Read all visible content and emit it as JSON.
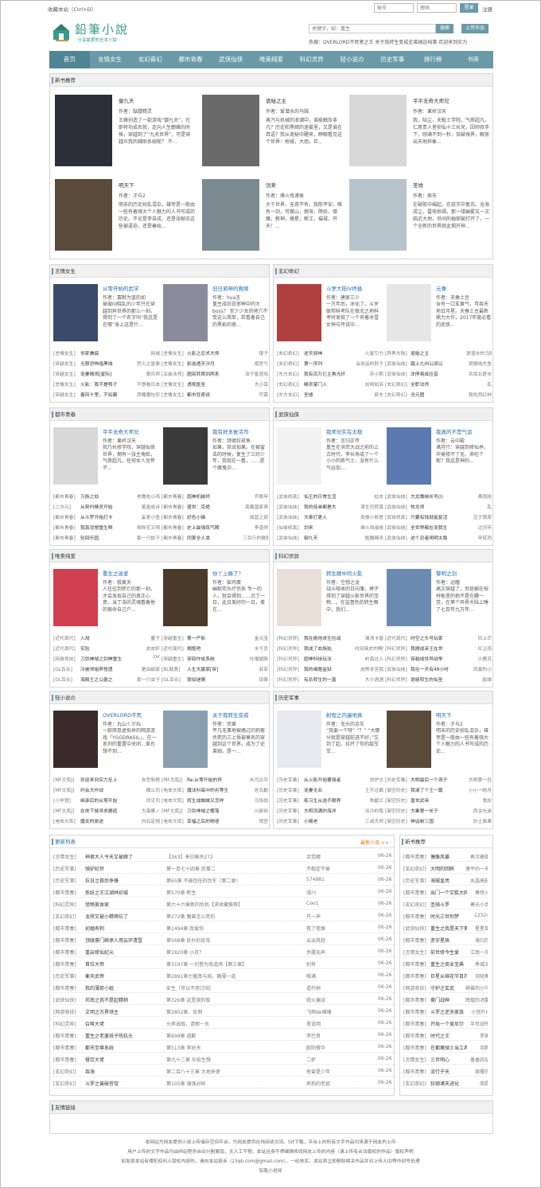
{
  "topbar": {
    "favorite": "收藏本站（Ctrl+D）",
    "account_placeholder": "帐号",
    "password_placeholder": "密码",
    "login": "登录",
    "register": "注册"
  },
  "logo": {
    "title": "鉛筆小說",
    "subtitle": "· 分享最愛的全本小說 ·"
  },
  "search": {
    "placeholder": "关键字，如：重生",
    "button": "搜索",
    "upload": "上传作品"
  },
  "hot": "热搜：OVERLORD不死者之王 关于我转生变成史莱姆这档事 欢迎来到实力",
  "nav": [
    "首页",
    "言情女生",
    "玄幻奇幻",
    "都市青春",
    "武侠仙侠",
    "唯美纯爱",
    "科幻灵异",
    "轻小说の",
    "历史军事",
    "排行榜",
    "书库"
  ],
  "new_books": {
    "title": "新书推荐",
    "items": [
      {
        "name": "御九天",
        "author": "作者：骷髅精灵",
        "desc": "王峰创造了一款游戏“御九天”，在即将功成名就，走向人生巅峰的时候，穿越到了“九天世界”，可是穿越众我的辅助系统呢？ 不...",
        "cover": "#2a2f3a"
      },
      {
        "name": "诡秘之主",
        "author": "作者：爱潜水的乌贼",
        "desc": "蒸汽与机械的浪潮中，谁能触及非凡？历史和黑暗的迷雾里，又是谁在耳语？我从诡秘中醒来，睁眼看见这个世界：枪械，大炮，巨...",
        "cover": "#6a6a6a"
      },
      {
        "name": "平平无奇大师兄",
        "author": "作者：果岭汉天",
        "desc": "我，陆尘，天魁土学院，气质超凡，仁慈贵人皆仰仙十三长兄，因师叔手下，刚满不到一秒，突破境界，解放出天地异象...",
        "cover": "#d8d8d8"
      },
      {
        "name": "明天下",
        "author": "作者：孑与2",
        "desc": "明末的历史纷乱混杂，雄宰是一般由一些有着强大个人魅力的人书写成的历史。不论是李自成，还是张献忠这些被逼迫，还是秦始...",
        "cover": "#5a4a3a"
      },
      {
        "name": "剑来",
        "author": "作者：烽火戏诸侯",
        "desc": "大千世界，无奇不有。我陈平安，唯有一剑，可搬山，倒海，降妖，镇魔，敕神，摘星，断江，摧城，开天！...",
        "cover": "#7a8a90"
      },
      {
        "name": "圣墟",
        "author": "作者：辰东",
        "desc": "在破败中崛起，在寂灭中复苏。沧海成尘，雷电枯竭，那一缕幽雾又一次临近大地，世间的枷锁被打开了，一个全新的世界就此揭开神...",
        "cover": "#b8c4cc"
      }
    ]
  },
  "categories": [
    {
      "title": "言情女生",
      "featured": [
        {
          "name": "从零开始的武学",
          "author": "作者：寡默为蓝的如",
          "desc": "被璇闷晓乱的少年只在穿越到异世界的那么一刻，得到了一个名字叫“我这是在哪”身上这是什...",
          "cover": "#3a4a6a"
        },
        {
          "name": "旧日邪神的救赎",
          "author": "作者：hua言",
          "desc": "重生成旧日邪神中的大boss？ 至少少女的地穴不受这么简单，若看着自己的黑影的爸...",
          "cover": "#8a8a9a"
        }
      ],
      "rows": [
        [
          "[言情女生]",
          "邻家兼搞",
          "网域",
          "[言情女生]",
          "火影之忍术大师",
          "银子"
        ],
        [
          "[穿越女生]",
          "无限恐怖暗黑域",
          "焚火之墨泰",
          "[言情女生]",
          "影逝透天汐月",
          "南宫兮"
        ],
        [
          "[穿越女生]",
          "宠妻微闹[星际]",
          "黄兵师",
          "[古装法师]",
          "圆亮转窝到两系",
          "双子星涯鸡"
        ],
        [
          "[言情女生]",
          "火影：我不是鸭子",
          "不想看日本",
          "[言情女生]",
          "透视医圣",
          "大小耳"
        ],
        [
          "[穿越女生]",
          "春风十里，不如霸",
          "西瞳魔怡安",
          "[言情女生]",
          "都市狂奇说",
          "可需"
        ]
      ]
    },
    {
      "title": "玄幻奇幻",
      "featured": [
        {
          "name": "斗罗大陆IV终极",
          "author": "作者：唐家三少",
          "desc": "一万年后，冰化了。斗罗联邦科考队在极北之地科考时发现了一个有着冰雪女神与传说中...",
          "cover": "#b04040"
        },
        {
          "name": "元尊",
          "author": "作者：天蚕土豆",
          "desc": "吾有一口玄黄气，可吞天地日月星。天蚕土豆最新鼎力大作，2017年度必看的武侠...",
          "cover": "#e6e6e6"
        }
      ],
      "rows": [
        [
          "[玄幻奇幻]",
          "逆天邪神",
          "火星引力",
          "[异界大陆]",
          "诡秘之主",
          "爱潜水的乌贼"
        ],
        [
          "[玄幻奇幻]",
          "第一序列",
          "会说话的肘子",
          "[武侠仙侠]",
          "踏上九州公双以",
          "铁锅炖大鱼"
        ],
        [
          "[东方玄幻]",
          "我有百万亿主角光环",
          "苏小熙",
          "[武侠仙侠]",
          "沈停易成往昔",
          "兵库北蒼长"
        ],
        [
          "[玄幻奇幻]",
          "精灵掌门人",
          "如倾如诉",
          "[玄幻奇幻]",
          "全职法师",
          "乱"
        ],
        [
          "[东方玄幻]",
          "圣墟",
          "辰东",
          "[玄幻奇幻]",
          "沧元图",
          "我吃西红柿"
        ]
      ]
    },
    {
      "title": "都市青春",
      "featured": [
        {
          "name": "平平无奇大师兄",
          "author": "作者：果岭汉天",
          "desc": "我乃长修学院，穿越仙侠世界，拥有一张主角脸，气质超凡，任何女人坐怀不...",
          "cover": "#d8d8d8"
        },
        {
          "name": "我有好多复活币",
          "author": "作者：拜德拉贰鱼",
          "desc": "如果，我说如果。在被雷击的时候，复生了三好少年，我现在一看，......是个魔鬼中...",
          "cover": "#3a3a3a"
        }
      ],
      "rows": [
        [
          "[都市青春]",
          "万族之劫",
          "老鹰吃小鸡",
          "[都市青春]",
          "超神机械师",
          "齐佩甲"
        ],
        [
          "[二次元]",
          "从契约精灵开始",
          "笔墨成诗",
          "[都市青春]",
          "盛世：克绝",
          "南萬国家茶"
        ],
        [
          "[都市青春]",
          "从斗罗开始打卡",
          "妄爱小鱼",
          "[都市青春]",
          "好色小猫",
          "孤蓝之孤"
        ],
        [
          "[都市青春]",
          "我真没想重生啊",
          "柳岸花又明",
          "[都市青春]",
          "史上最强炼气期",
          "李道然"
        ],
        [
          "[都市青春]",
          "轮回乐园",
          "那一只蚊子",
          "[都市青春]",
          "同美全人类",
          "三百斤的微笑"
        ]
      ]
    },
    {
      "title": "武侠仙侠",
      "featured": [
        {
          "name": "我师兄实在太稳",
          "author": "作者：言归正传",
          "desc": "重生在洪荒大战之前的上古时代，李长寿成了一个小小的炼气士，没有什么气运加...",
          "cover": "#f2f2f2"
        },
        {
          "name": "我真的不是气运",
          "author": "作者：云中殿",
          "desc": "诸月行：穿越到修仙界，毕竟修不了无，来吃个呢？我这是神的...",
          "cover": "#5a7ab0"
        }
      ],
      "rows": [
        [
          "[武侠修真]",
          "仙王的日常生活",
          "枯玄",
          "[武侠仙侠]",
          "大龙鹰峡长号(l)",
          "萧雨晗"
        ],
        [
          "[武侠仙侠]",
          "我的徒弟都是大",
          "谋生任转蓬",
          "[武侠仙侠]",
          "牧龙师",
          "乱"
        ],
        [
          "[武侠仙侠]",
          "大奉打更人",
          "卖报小郎君",
          "[武侠修真]",
          "只要有钱就能复活",
          "豆子蔬菜"
        ],
        [
          "[仙侠修真]",
          "剑来",
          "烽火戏诸侯",
          "[武侠仙侠]",
          "全世界都在宠我生",
          "过河卒"
        ],
        [
          "[武侠仙侠]",
          "御九天",
          "骷髅精灵",
          "[武侠仙侠]",
          "这个忍者明明太稳",
          "甲贰丙"
        ]
      ]
    },
    {
      "title": "唯美纯爱",
      "featured": [
        {
          "name": "重生之迷爱",
          "author": "作者：殺氣天",
          "desc": "人往往到死亡的那一刻，才会发现自己的真正心意。当丁浩的灵魂看着他的宿命自己户...",
          "cover": "#d04050"
        },
        {
          "name": "你丫上瘾了？",
          "author": "作者：柴鸡蛋",
          "desc": "幽默欢乐疗伤系 专一的人，就会得到……沿丁一日，此日美好的一日，美在...",
          "cover": "#4a3a2a"
        }
      ],
      "rows": [
        [
          "[近代现代]",
          "入戏",
          "董子",
          "[穿越重生]",
          "第一严影",
          "金元宝"
        ],
        [
          "[近代现代]",
          "实验",
          "皮皮虾",
          "[近代现代]",
          "拥抱吧",
          "水千丞"
        ],
        [
          "[网游竞技]",
          "刀剑神域之剑神重生",
          "zxr",
          "[穿越重生]",
          "穿回作成系统",
          "怜惺翅豚"
        ],
        [
          "[GL百合]",
          "冷被师姐养怪遗",
          "是血甜宴",
          "[BL耽美]",
          "人生大赢家[穿]",
          "菲菲"
        ],
        [
          "[GL百合]",
          "海贼王之公爵之",
          "那一只虫子",
          "[GL百合]",
          "铁狱迷情",
          "琼斐"
        ]
      ]
    },
    {
      "title": "科幻灵异",
      "featured": [
        {
          "name": "转生眼中的火影",
          "author": "作者：空想之龙",
          "desc": "战斗吸收的日向雏，拷子得到了穿越火影世界的宝物...。在监督危的转生眼中，我们...",
          "cover": "#e8e0d8"
        },
        {
          "name": "黎明之剑",
          "author": "作者：远瞳",
          "desc": "高文穿越了，但是躺在棺材板里的他不是在醒一觉，在第个异界大陆上睡了七百年九万年...",
          "cover": "#6a8ab0"
        }
      ],
      "rows": [
        [
          "[科幻灵异]",
          "我在绝地求生捡战",
          "清湾卡普",
          "[近代现代]",
          "时空之头号玩家",
          "风上芒"
        ],
        [
          "[科幻灵异]",
          "我成了血族始",
          "时间简史的鳄鱼",
          "[科幻灵异]",
          "我拥成亲王在世",
          "红尘雨"
        ],
        [
          "[科幻灵异]",
          "超神科技玩法",
          "岭南过人",
          "[科幻灵异]",
          "穿越成世异战争",
          "小鹿苏"
        ],
        [
          "[科幻灵异]",
          "我的细胞监狱",
          "皮熊甘苦我",
          "[武侠仙侠]",
          "我在一天有48小时",
          "风景的小"
        ],
        [
          "[科幻灵异]",
          "有杀转生的一直",
          "大小酒酒",
          "[科幻灵异]",
          "诡秘转生的仙圣",
          "欧维"
        ]
      ]
    },
    {
      "title": "轻小说の",
      "featured": [
        {
          "name": "OVERLORD不死",
          "author": "作者：丸山くがね",
          "desc": "一款席卷虚拟界的网游游戏「YGGDRASIL」，在一系列的重置中关闭...谁也想不到...",
          "cover": "#3a2a2a"
        },
        {
          "name": "关于我转生变成",
          "author": "作者：伏柬",
          "desc": "平凡无事地被路过的刺客杀死的三上悟被莫名的穿越到这个世界，成为了史莱姆，是一...",
          "cover": "#8aa0b0"
        }
      ],
      "rows": [
        [
          "[MF文库J]",
          "欢迎来到实力至上",
          "衣笠彰梧",
          "[MF文库J]",
          "Re:从零开始的异",
          "长月达平"
        ],
        [
          "[MF文库J]",
          "约会大作战",
          "橘公司",
          "[电击文库]",
          "魔法科高中的劣等生",
          "佐岛勤"
        ],
        [
          "[小学馆]",
          "继承后的从零开始",
          "伏见司",
          "[电击文库]",
          "转生成蜘蛛又怎样",
          "马场翁"
        ],
        [
          "[MF文库J]",
          "在地下城寻求邂逅",
          "大森藤ノ",
          "[MF文库J]",
          "刀剑神域之樱落",
          "川原砾"
        ],
        [
          "[电击文库]",
          "魔女的旅途",
          "白石定规",
          "[电击文库]",
          "幸福之后的物语",
          "雨宫"
        ]
      ]
    },
    {
      "title": "历史军事",
      "featured": [
        {
          "name": "射程之内遍地真",
          "author": "作者：无头的余灰",
          "desc": "“我要一个呀” “？” “大哪分就是穿越前进不好，”又到了起，拉开了你的敌军军...",
          "cover": "#e8e8f0"
        },
        {
          "name": "明天下",
          "author": "作者：孑与2",
          "desc": "明末的历史纷乱混杂，雄宰是一般由一些有着强大个人魅力的人书写成的历史...",
          "cover": "#5a4a3a"
        }
      ],
      "rows": [
        [
          "[历史军事]",
          "从火影开始要强者",
          "剑炉文",
          "[历史军事]",
          "大明最后一个浪子",
          "大明第一狂"
        ],
        [
          "[历史军事]",
          "宠妻无名",
          "王不过霸",
          "[架空历史]",
          "我请了个王一篇",
          "小小一帆舟"
        ],
        [
          "[历史军事]",
          "练习生从选手眼界",
          "陈碧兰",
          "[架空历史]",
          "盖世武帝",
          "鬼权"
        ],
        [
          "[历史军事]",
          "大明流满的海洋",
          "冰冷的我",
          "[架空历史]",
          "大秦第一长子",
          "西关吐迷"
        ],
        [
          "[历史军事]",
          "小阁老",
          "三戒大师",
          "[架空历史]",
          "神话制三国",
          "炒土面果"
        ]
      ]
    }
  ],
  "updates": {
    "title": "更新列表",
    "more": "最新小说 >>",
    "rows": [
      [
        "[言情女生]",
        "神君大人今天又被嫁了",
        "【363】来日榆杀272",
        "余觉娜",
        "06-26"
      ],
      [
        "[历史军事]",
        "骑驴纪世",
        "第一百七十四章 后事二",
        "不稳定不倦",
        "06-26"
      ],
      [
        "[历史军事]",
        "抗日之救后争锋",
        "第65章 不被信任的伪军（第二更）",
        "574981",
        "06-26"
      ],
      [
        "[都市青春]",
        "炼妖之王江湖林初城",
        "第570章 新生",
        "浸川",
        "06-26"
      ],
      [
        "[科幻灵异]",
        "怪物美食家",
        "第六十六章新的危机【求收藏推荐】",
        "Coo1",
        "06-26"
      ],
      [
        "[玄幻奇幻]",
        "龙将又被小精萌坑了",
        "第272章 魔兽怎么死的",
        "尺一声",
        "06-26"
      ],
      [
        "[都市青春]",
        "初婚有刺",
        "第1494章 我爱你",
        "苞了苞猴",
        "06-26"
      ],
      [
        "[都市青春]",
        "顶级豪门继承人用云环清雪",
        "第568章 反扑的反攻",
        "云淡风轻",
        "06-26"
      ],
      [
        "[都市青春]",
        "重启修仙纪元",
        "第1820章 小月？",
        "步履无声",
        "06-26"
      ],
      [
        "[都市青春]",
        "首位大帝",
        "第3197章 一切皆为我道场【第三章】",
        "别有",
        "06-26"
      ],
      [
        "[历史军事]",
        "衡天武帝",
        "第2891章力量真与局，确薄一道",
        "唯满",
        "06-26"
      ],
      [
        "[都市青春]",
        "我的薄荷小姐",
        "安生（可以不用订阅）",
        "道柠树",
        "06-26"
      ],
      [
        "[武侠仙侠]",
        "祁南之我不是起精稍",
        "第326章 这是我的叙",
        "炮火遍派",
        "06-26"
      ],
      [
        "[网游竞技]",
        "文明之万界领主",
        "第2802章、反制",
        "飞翔de啸啸",
        "06-26"
      ],
      [
        "[科幻灵异]",
        "召唤大佬",
        "头疼选取，请假一天",
        "里说明",
        "06-26"
      ],
      [
        "[都市青春]",
        "重生之老婆孩子热炕头",
        "第699章 道歉",
        "李巴哥",
        "06-26"
      ],
      [
        "[都市青春]",
        "都市至尊系统",
        "第513章 李妙天",
        "欧阳傲华",
        "06-26"
      ],
      [
        "[都市青春]",
        "餐饮大佬",
        "第九十二章 乐怡生想",
        "二虾",
        "06-26"
      ],
      [
        "[玄幻奇幻]",
        "吞海",
        "第二百八十三章 大地来使",
        "他曾是少年",
        "06-26"
      ],
      [
        "[玄幻奇幻]",
        "斗罗之兽破苍穹",
        "第105章 强强对碎",
        "养狗的老姐",
        "06-26"
      ]
    ]
  },
  "side_recommend": {
    "title": "新书推荐",
    "rows": [
      [
        "[都市青春]",
        "偶像风暴",
        "再次蜂蜡"
      ],
      [
        "[玄幻奇幻]",
        "大明的回眸",
        "落平的一天"
      ],
      [
        "[历史军事]",
        "海贼皇亮",
        "水晶高鞋"
      ],
      [
        "[都市青春]",
        "出门一个交狐大网",
        "萧然火"
      ],
      [
        "[玄幻奇幻]",
        "圣骑斗罗",
        "萧光小手"
      ],
      [
        "[都市青春]",
        "时光三世烈梦",
        "12324"
      ],
      [
        "[武侠仙侠]",
        "重生之我是天下第一",
        "星星草"
      ],
      [
        "[都市青春]",
        "赤宇星辰",
        "海归月"
      ],
      [
        "[言情女生]",
        "前世修今生爱",
        "江南一乐"
      ],
      [
        "[都市青春]",
        "重生之商业宝典",
        "秀城凉"
      ],
      [
        "[都市青春]",
        "巨星从绵花节目开始",
        "羽轻寒"
      ],
      [
        "[网游竞技]",
        "守护之玄武",
        "神兽的小乌龟"
      ],
      [
        "[都市青春]",
        "豪门战神",
        "辉煌的鸿蒙"
      ],
      [
        "[都市青春]",
        "斗罗之逆天家族",
        "小宫叶H"
      ],
      [
        "[都市青春]",
        "开局一个美尼尔",
        "半世战帝"
      ],
      [
        "[都市青春]",
        "时代之王",
        "罗峰"
      ],
      [
        "[都市青春]",
        "在都寓骑士当工具人",
        "羽鹊"
      ],
      [
        "[言情女生]",
        "三世明心",
        "墨香四溢"
      ],
      [
        "[都市青春]",
        "流行于天",
        "周儒宗"
      ],
      [
        "[玄幻奇幻]",
        "狂顿诸天进化",
        "南霞"
      ]
    ]
  },
  "friend_links": {
    "title": "友情链接"
  },
  "footer": [
    "本网站为网友提供小说上传储存空间平台，为网友提供在线阅读交流、txt下载，平台上的所有文字作品均来源于网友的上传",
    "用户上传的文字作品均由网站程序自动分割展现，无人工干预，本站且身不得编辑修改网友上传的内容（请上传有合法版权的作品）版权声明",
    "如发现本站有侵犯权利人版权内容的，请向本站投诉（23qb.com@gmail.com），一经核实，本站将立即删除相关作品并对上传人ID等作封号处理",
    "铅笔小说网"
  ]
}
